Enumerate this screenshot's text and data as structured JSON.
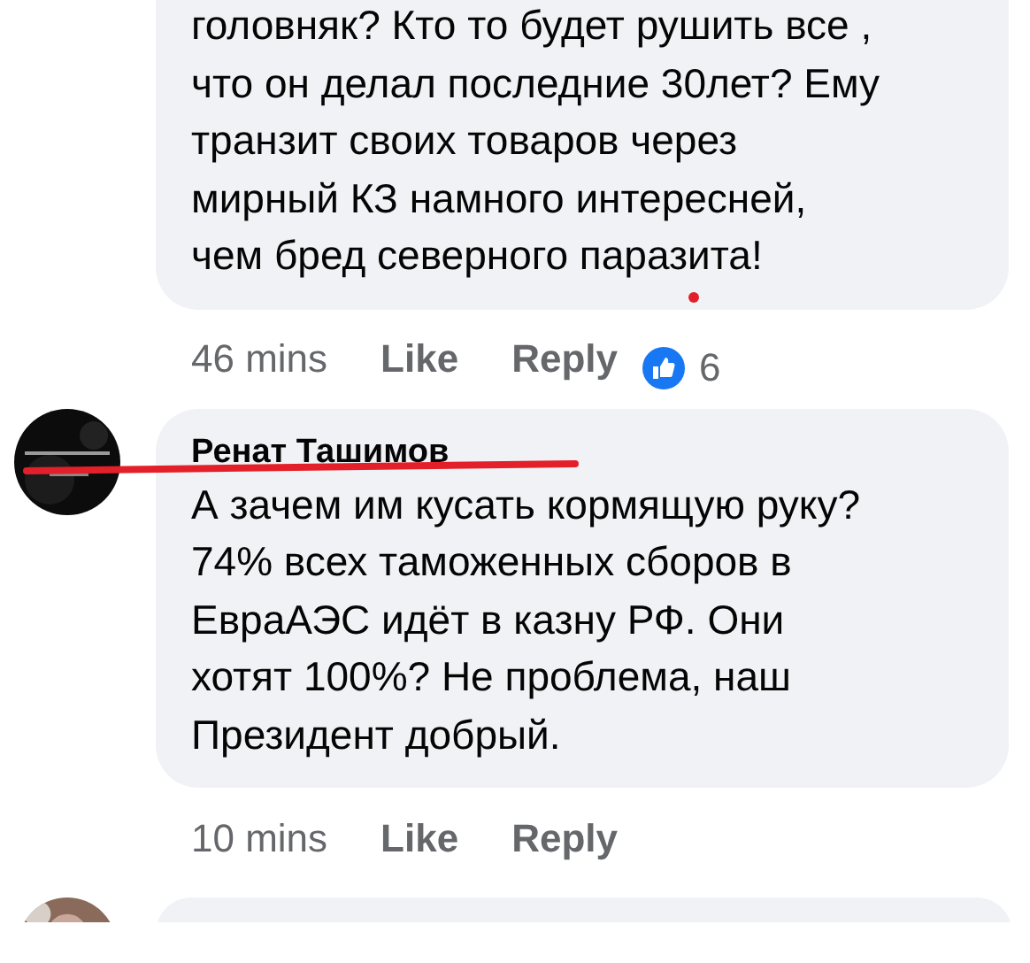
{
  "comments": [
    {
      "text": "головняк? Кто то будет рушить все ,\nчто он делал последние 30лет? Ему\nтранзит своих товаров через\nмирный КЗ намного интересней,\nчем бред северного паразита!",
      "time": "46 mins",
      "like": "Like",
      "reply": "Reply",
      "reactions": "6"
    },
    {
      "author": "Ренат Ташимов",
      "text": "А зачем им кусать кормящую руку?\n74% всех таможенных сборов в\nЕвраАЭС идёт в казну РФ. Они\nхотят 100%? Не проблема, наш\nПрезидент добрый.",
      "time": "10 mins",
      "like": "Like",
      "reply": "Reply"
    }
  ]
}
